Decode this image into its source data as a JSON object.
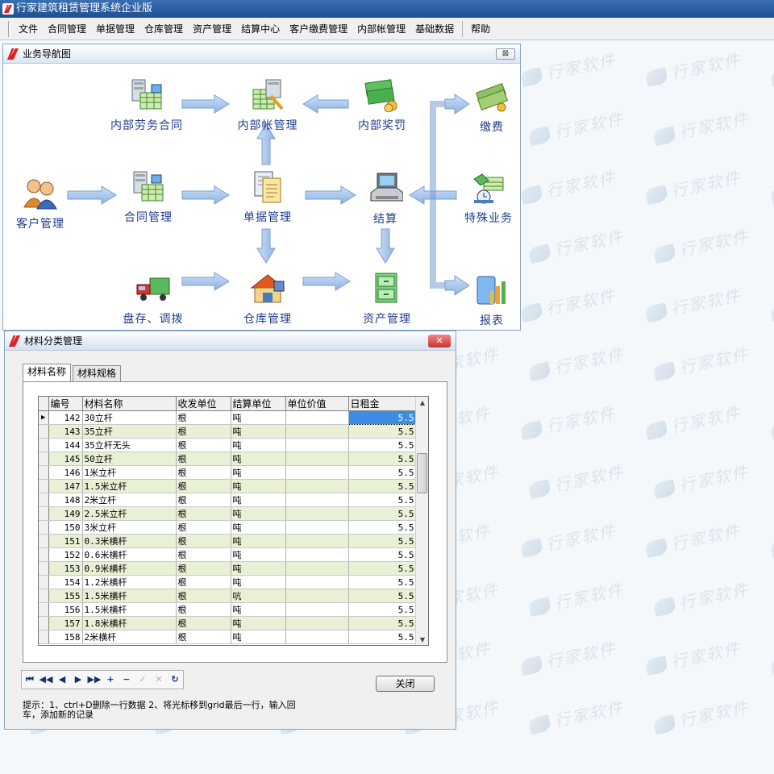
{
  "app": {
    "title": "行家建筑租赁管理系统企业版"
  },
  "watermark": {
    "text": "行家软件"
  },
  "menu": [
    "文件",
    "合同管理",
    "单据管理",
    "仓库管理",
    "资产管理",
    "结算中心",
    "客户缴费管理",
    "内部帐管理",
    "基础数据",
    "帮助"
  ],
  "nav_window": {
    "title": "业务导航图",
    "close_label": "⊠",
    "nodes": {
      "labor_contract": "内部劳务合同",
      "internal_account": "内部帐管理",
      "internal_reward": "内部奖罚",
      "payment": "缴费",
      "customer": "客户管理",
      "contract": "合同管理",
      "receipt": "单据管理",
      "settlement": "结算",
      "special": "特殊业务",
      "inventory": "盘存、调拨",
      "warehouse": "仓库管理",
      "asset": "资产管理",
      "report": "报表"
    }
  },
  "material_window": {
    "title": "材料分类管理",
    "close_label": "✕",
    "tabs": [
      "材料名称",
      "材料规格"
    ],
    "columns": [
      "编号",
      "材料名称",
      "收发单位",
      "结算单位",
      "单位价值",
      "日租金"
    ],
    "rows": [
      {
        "id": "142",
        "name": "30立杆",
        "issue_unit": "根",
        "settle_unit": "吨",
        "unit_value": "",
        "daily_rent": "5.5"
      },
      {
        "id": "143",
        "name": "35立杆",
        "issue_unit": "根",
        "settle_unit": "吨",
        "unit_value": "",
        "daily_rent": "5.5"
      },
      {
        "id": "144",
        "name": "35立杆无头",
        "issue_unit": "根",
        "settle_unit": "吨",
        "unit_value": "",
        "daily_rent": "5.5"
      },
      {
        "id": "145",
        "name": "50立杆",
        "issue_unit": "根",
        "settle_unit": "吨",
        "unit_value": "",
        "daily_rent": "5.5"
      },
      {
        "id": "146",
        "name": "1米立杆",
        "issue_unit": "根",
        "settle_unit": "吨",
        "unit_value": "",
        "daily_rent": "5.5"
      },
      {
        "id": "147",
        "name": "1.5米立杆",
        "issue_unit": "根",
        "settle_unit": "吨",
        "unit_value": "",
        "daily_rent": "5.5"
      },
      {
        "id": "148",
        "name": "2米立杆",
        "issue_unit": "根",
        "settle_unit": "吨",
        "unit_value": "",
        "daily_rent": "5.5"
      },
      {
        "id": "149",
        "name": "2.5米立杆",
        "issue_unit": "根",
        "settle_unit": "吨",
        "unit_value": "",
        "daily_rent": "5.5"
      },
      {
        "id": "150",
        "name": "3米立杆",
        "issue_unit": "根",
        "settle_unit": "吨",
        "unit_value": "",
        "daily_rent": "5.5"
      },
      {
        "id": "151",
        "name": "0.3米横杆",
        "issue_unit": "根",
        "settle_unit": "吨",
        "unit_value": "",
        "daily_rent": "5.5"
      },
      {
        "id": "152",
        "name": "0.6米横杆",
        "issue_unit": "根",
        "settle_unit": "吨",
        "unit_value": "",
        "daily_rent": "5.5"
      },
      {
        "id": "153",
        "name": "0.9米横杆",
        "issue_unit": "根",
        "settle_unit": "吨",
        "unit_value": "",
        "daily_rent": "5.5"
      },
      {
        "id": "154",
        "name": "1.2米横杆",
        "issue_unit": "根",
        "settle_unit": "吨",
        "unit_value": "",
        "daily_rent": "5.5"
      },
      {
        "id": "155",
        "name": "1.5米横杆",
        "issue_unit": "根",
        "settle_unit": "吭",
        "unit_value": "",
        "daily_rent": "5.5"
      },
      {
        "id": "156",
        "name": "1.5米横杆",
        "issue_unit": "根",
        "settle_unit": "吨",
        "unit_value": "",
        "daily_rent": "5.5"
      },
      {
        "id": "157",
        "name": "1.8米横杆",
        "issue_unit": "根",
        "settle_unit": "吨",
        "unit_value": "",
        "daily_rent": "5.5"
      },
      {
        "id": "158",
        "name": "2米横杆",
        "issue_unit": "根",
        "settle_unit": "吨",
        "unit_value": "",
        "daily_rent": "5.5"
      }
    ],
    "close_button": "关闭",
    "hint": "提示：1、ctrl+D删除一行数据   2、将光标移到grid最后一行，输入回车，添加新的记录",
    "nav_buttons": [
      "⏮",
      "◀◀",
      "◀",
      "▶",
      "▶▶",
      "+",
      "−",
      "✓",
      "✕",
      "↻"
    ]
  }
}
